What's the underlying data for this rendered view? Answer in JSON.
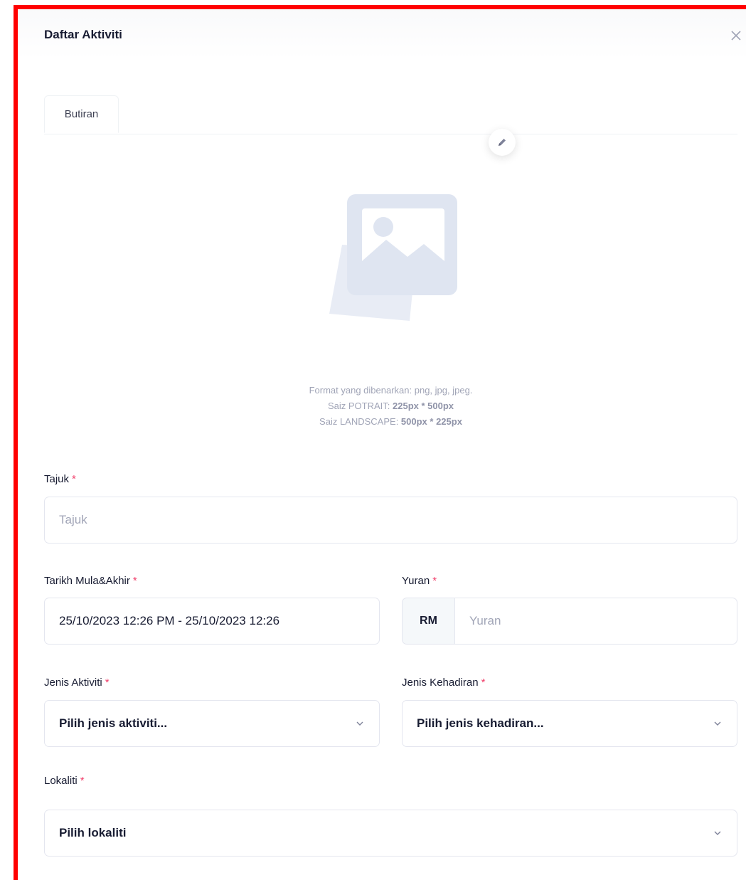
{
  "modal": {
    "title": "Daftar Aktiviti"
  },
  "tabs": [
    {
      "label": "Butiran"
    }
  ],
  "image_hint": {
    "line1": "Format yang dibenarkan: png, jpg, jpeg.",
    "line2_prefix": "Saiz POTRAIT: ",
    "line2_value": "225px * 500px",
    "line3_prefix": "Saiz LANDSCAPE: ",
    "line3_value": "500px * 225px"
  },
  "form": {
    "required_mark": "*",
    "tajuk": {
      "label": "Tajuk",
      "placeholder": "Tajuk"
    },
    "tarikh": {
      "label": "Tarikh Mula&Akhir",
      "value": "25/10/2023 12:26 PM - 25/10/2023 12:26"
    },
    "yuran": {
      "label": "Yuran",
      "addon": "RM",
      "placeholder": "Yuran"
    },
    "jenis_aktiviti": {
      "label": "Jenis Aktiviti",
      "selected": "Pilih jenis aktiviti..."
    },
    "jenis_kehadiran": {
      "label": "Jenis Kehadiran",
      "selected": "Pilih jenis kehadiran..."
    },
    "lokaliti": {
      "label": "Lokaliti",
      "selected": "Pilih lokaliti"
    }
  },
  "icons": {
    "close": "close-icon",
    "edit": "pencil-icon",
    "image": "image-placeholder-icon",
    "chevron": "chevron-down-icon"
  },
  "colors": {
    "frame_border": "#ff0000",
    "required": "#f1416c",
    "placeholder_art": "#dfe5f1"
  }
}
